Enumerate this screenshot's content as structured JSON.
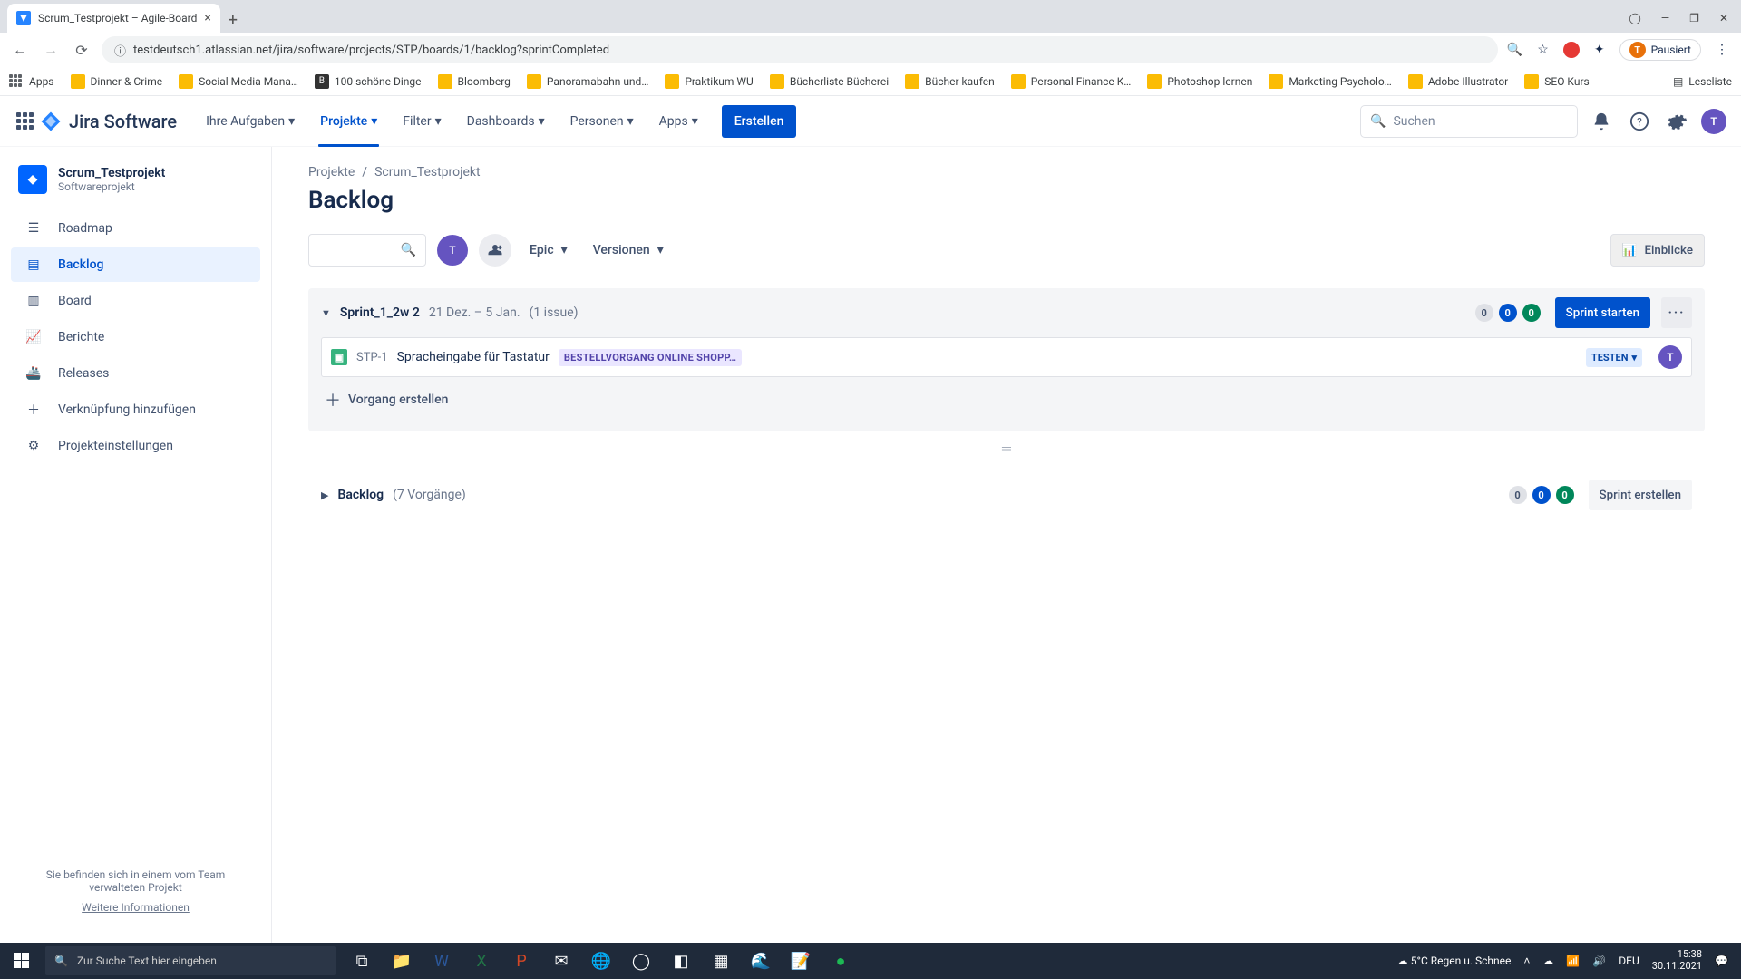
{
  "browser": {
    "tab_title": "Scrum_Testprojekt – Agile-Board",
    "url": "testdeutsch1.atlassian.net/jira/software/projects/STP/boards/1/backlog?sprintCompleted",
    "profile_status": "Pausiert",
    "bookmarks": [
      "Apps",
      "Dinner & Crime",
      "Social Media Mana…",
      "100 schöne Dinge",
      "Bloomberg",
      "Panoramabahn und…",
      "Praktikum WU",
      "Bücherliste Bücherei",
      "Bücher kaufen",
      "Personal Finance K…",
      "Photoshop lernen",
      "Marketing Psycholo…",
      "Adobe Illustrator",
      "SEO Kurs"
    ],
    "bookmark_overflow": "Leseliste"
  },
  "jira_header": {
    "logo_text": "Jira Software",
    "nav": [
      "Ihre Aufgaben",
      "Projekte",
      "Filter",
      "Dashboards",
      "Personen",
      "Apps"
    ],
    "active_nav_index": 1,
    "create_btn": "Erstellen",
    "search_placeholder": "Suchen",
    "avatar_initial": "T"
  },
  "sidebar": {
    "project_name": "Scrum_Testprojekt",
    "project_type": "Softwareprojekt",
    "items": [
      "Roadmap",
      "Backlog",
      "Board",
      "Berichte",
      "Releases",
      "Verknüpfung hinzufügen",
      "Projekteinstellungen"
    ],
    "active_index": 1,
    "footer_text": "Sie befinden sich in einem vom Team verwalteten Projekt",
    "footer_link": "Weitere Informationen"
  },
  "main": {
    "breadcrumb": [
      "Projekte",
      "Scrum_Testprojekt"
    ],
    "title": "Backlog",
    "filters": {
      "epic": "Epic",
      "versions": "Versionen"
    },
    "insights_btn": "Einblicke",
    "avatar_initial": "T",
    "sprint": {
      "name": "Sprint_1_2w 2",
      "date_range": "21 Dez. – 5 Jan.",
      "count": "(1 issue)",
      "pills": [
        "0",
        "0",
        "0"
      ],
      "start_btn": "Sprint starten",
      "issue": {
        "key": "STP-1",
        "summary": "Spracheingabe für Tastatur",
        "epic": "BESTELLVORGANG ONLINE SHOPP…",
        "status": "TESTEN",
        "assignee_initial": "T"
      },
      "create_label": "Vorgang erstellen"
    },
    "backlog_section": {
      "name": "Backlog",
      "count": "(7 Vorgänge)",
      "pills": [
        "0",
        "0",
        "0"
      ],
      "create_btn": "Sprint erstellen"
    }
  },
  "taskbar": {
    "search_placeholder": "Zur Suche Text hier eingeben",
    "weather": "5°C  Regen u. Schnee",
    "lang": "DEU",
    "time": "15:38",
    "date": "30.11.2021"
  }
}
